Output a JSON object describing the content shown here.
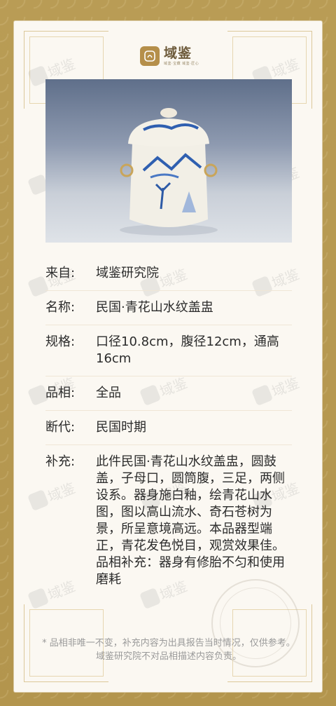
{
  "logo": {
    "name": "域鉴",
    "subtitle": "域鉴·宝藏 域鉴·匠心"
  },
  "details": [
    {
      "label": "来自:",
      "value": "域鉴研究院"
    },
    {
      "label": "名称:",
      "value": "民国·青花山水纹盖盅"
    },
    {
      "label": "规格:",
      "value": "口径10.8cm，腹径12cm，通高16cm"
    },
    {
      "label": "品相:",
      "value": "全品"
    },
    {
      "label": "断代:",
      "value": "民国时期"
    },
    {
      "label": "补充:",
      "value": "此件民国·青花山水纹盖盅，圆鼓盖，子母口，圆筒腹，三足，两侧设系。器身施白釉，绘青花山水图，图以高山流水、奇石苍树为景，所呈意境高远。本品器型端正，青花发色悦目，观赏效果佳。品相补充：器身有修胎不匀和使用磨耗"
    }
  ],
  "footer": "* 品相非唯一不变，补充内容为出具报告当时情况，仅供参考。域鉴研究院不对品相描述内容负责。",
  "watermark_text": "域鉴",
  "seal_text": "鉴 院 研 究",
  "colors": {
    "frame": "#b89a52",
    "card": "#fbf8f2",
    "text": "#2b2b2b"
  }
}
